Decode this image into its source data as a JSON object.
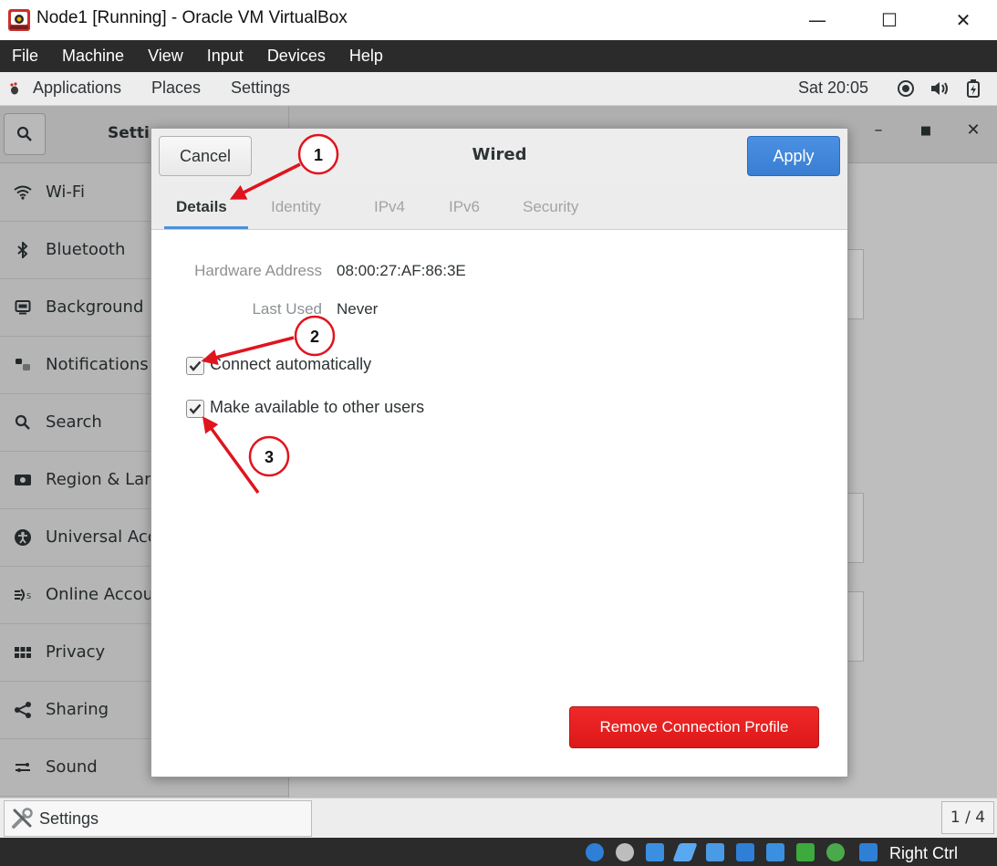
{
  "host_window": {
    "title": "Node1 [Running] - Oracle VM VirtualBox",
    "controls": {
      "minimize": "—",
      "maximize": "☐",
      "close": "✕"
    }
  },
  "vb_menu": [
    "File",
    "Machine",
    "View",
    "Input",
    "Devices",
    "Help"
  ],
  "gnome_topbar": {
    "applications": "Applications",
    "places": "Places",
    "settings": "Settings",
    "clock": "Sat 20:05"
  },
  "settings_sidebar": {
    "title": "Setti",
    "items": [
      {
        "label": "Wi-Fi",
        "icon": "wifi-icon"
      },
      {
        "label": "Bluetooth",
        "icon": "bluetooth-icon"
      },
      {
        "label": "Background",
        "icon": "background-icon"
      },
      {
        "label": "Notifications",
        "icon": "notifications-icon"
      },
      {
        "label": "Search",
        "icon": "search-icon"
      },
      {
        "label": "Region & Lan",
        "icon": "region-icon"
      },
      {
        "label": "Universal Acc",
        "icon": "accessibility-icon"
      },
      {
        "label": "Online Accou",
        "icon": "online-accounts-icon"
      },
      {
        "label": "Privacy",
        "icon": "privacy-icon"
      },
      {
        "label": "Sharing",
        "icon": "sharing-icon"
      },
      {
        "label": "Sound",
        "icon": "sound-icon"
      }
    ]
  },
  "dialog": {
    "cancel": "Cancel",
    "title": "Wired",
    "apply": "Apply",
    "tabs": [
      {
        "label": "Details",
        "active": true
      },
      {
        "label": "Identity",
        "active": false
      },
      {
        "label": "IPv4",
        "active": false
      },
      {
        "label": "IPv6",
        "active": false
      },
      {
        "label": "Security",
        "active": false
      }
    ],
    "hardware_address_label": "Hardware Address",
    "hardware_address_value": "08:00:27:AF:86:3E",
    "last_used_label": "Last Used",
    "last_used_value": "Never",
    "connect_automatically": {
      "label": "Connect automatically",
      "checked": true
    },
    "make_available": {
      "label": "Make available to other users",
      "checked": true
    },
    "remove_button": "Remove Connection Profile"
  },
  "bottom_bar": {
    "task_label": "Settings",
    "pager": "1 / 4"
  },
  "status_bar": {
    "host_key": "Right Ctrl"
  },
  "annotations": [
    "1",
    "2",
    "3"
  ],
  "colors": {
    "accent_blue": "#3a7ed3",
    "destructive_red": "#e01b1b",
    "annotation_red": "#e0141e",
    "vb_dark": "#2b2b2b"
  }
}
